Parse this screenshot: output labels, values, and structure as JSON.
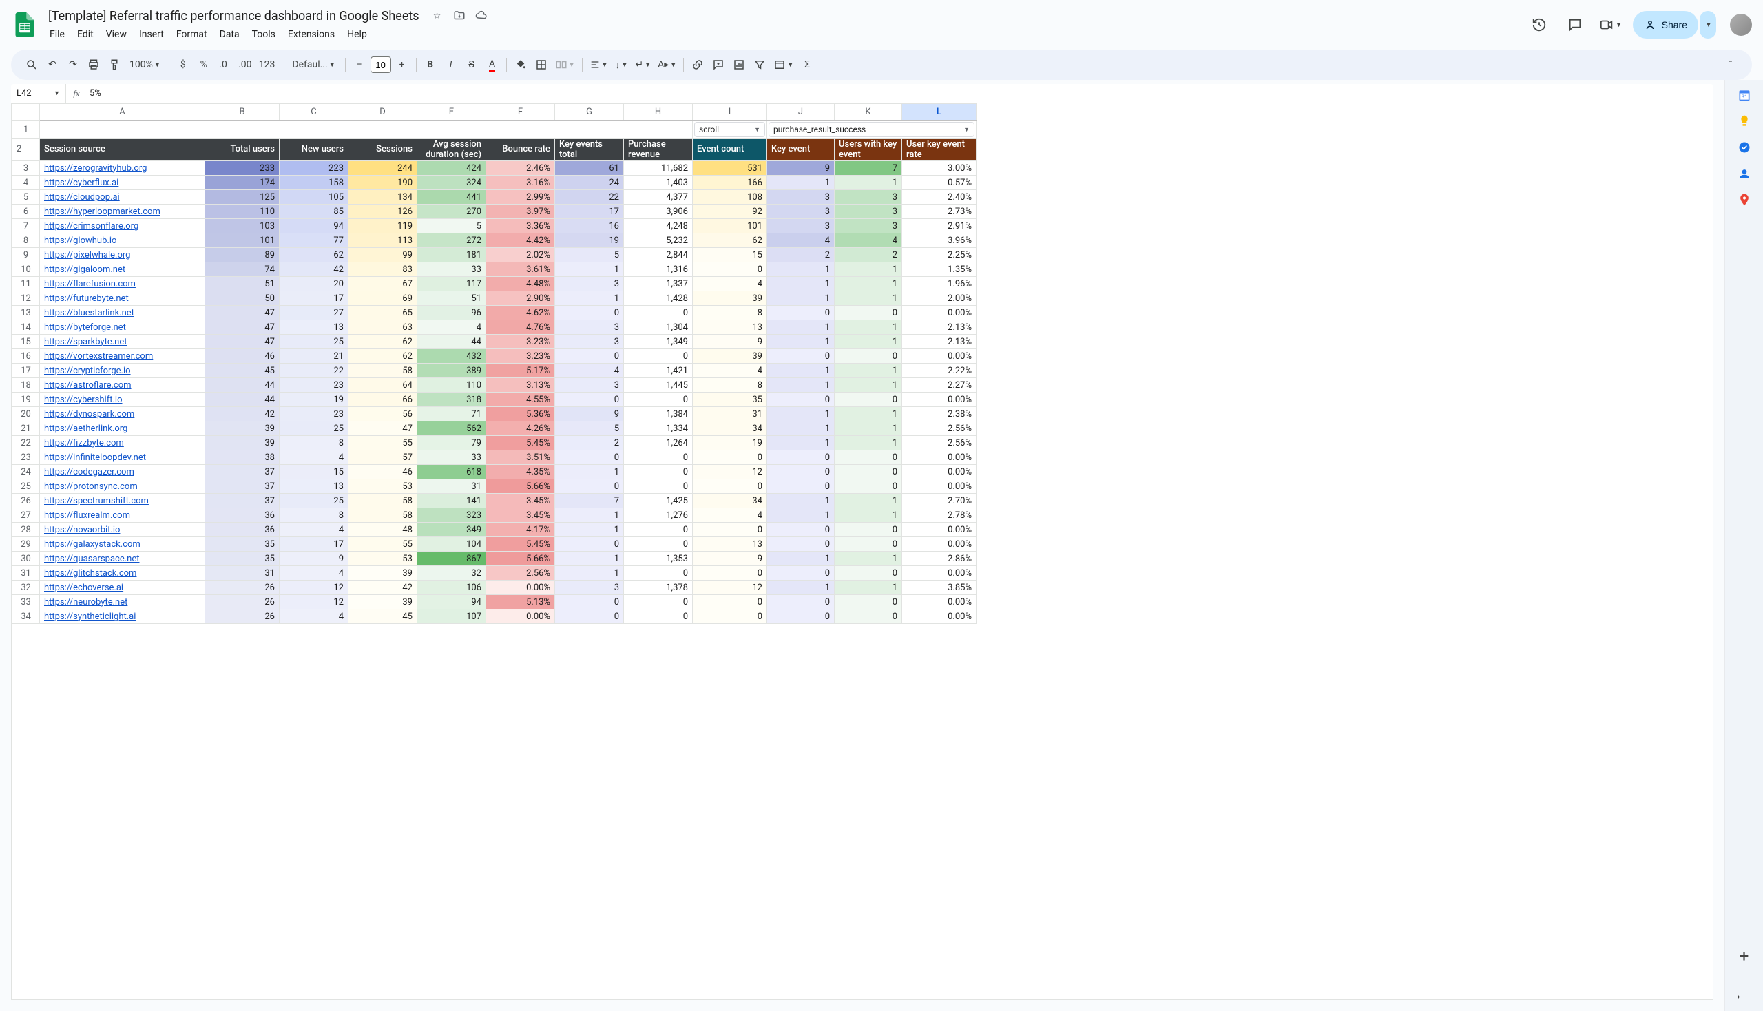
{
  "doc": {
    "title": "[Template] Referral traffic performance dashboard in Google Sheets"
  },
  "menu": {
    "file": "File",
    "edit": "Edit",
    "view": "View",
    "insert": "Insert",
    "format": "Format",
    "data": "Data",
    "tools": "Tools",
    "extensions": "Extensions",
    "help": "Help"
  },
  "share": {
    "label": "Share"
  },
  "toolbar": {
    "zoom": "100%",
    "font": "Defaul...",
    "size": "10"
  },
  "namebox": {
    "cell": "L42",
    "formula": "5%"
  },
  "filters": {
    "event_count": "scroll",
    "key_event": "purchase_result_success"
  },
  "cols": [
    "",
    "A",
    "B",
    "C",
    "D",
    "E",
    "F",
    "G",
    "H",
    "I",
    "J",
    "K",
    "L"
  ],
  "headers": {
    "a": "Session source",
    "b": "Total users",
    "c": "New users",
    "d": "Sessions",
    "e": "Avg session duration (sec)",
    "f": "Bounce rate",
    "g": "Key events total",
    "h": "Purchase revenue",
    "i": "Event count",
    "j": "Key event",
    "k": "Users with key event",
    "l": "User key event rate"
  },
  "rows": [
    {
      "a": "https://zerogravityhub.org",
      "b": "233",
      "c": "223",
      "d": "244",
      "e": "424",
      "f": "2.46%",
      "g": "61",
      "h": "11,682",
      "i": "531",
      "j": "9",
      "k": "7",
      "l": "3.00%"
    },
    {
      "a": "https://cyberflux.ai",
      "b": "174",
      "c": "158",
      "d": "190",
      "e": "324",
      "f": "3.16%",
      "g": "24",
      "h": "1,403",
      "i": "166",
      "j": "1",
      "k": "1",
      "l": "0.57%"
    },
    {
      "a": "https://cloudpop.ai",
      "b": "125",
      "c": "105",
      "d": "134",
      "e": "441",
      "f": "2.99%",
      "g": "22",
      "h": "4,377",
      "i": "108",
      "j": "3",
      "k": "3",
      "l": "2.40%"
    },
    {
      "a": "https://hyperloopmarket.com",
      "b": "110",
      "c": "85",
      "d": "126",
      "e": "270",
      "f": "3.97%",
      "g": "17",
      "h": "3,906",
      "i": "92",
      "j": "3",
      "k": "3",
      "l": "2.73%"
    },
    {
      "a": "https://crimsonflare.org",
      "b": "103",
      "c": "94",
      "d": "119",
      "e": "5",
      "f": "3.36%",
      "g": "16",
      "h": "4,248",
      "i": "101",
      "j": "3",
      "k": "3",
      "l": "2.91%"
    },
    {
      "a": "https://glowhub.io",
      "b": "101",
      "c": "77",
      "d": "113",
      "e": "272",
      "f": "4.42%",
      "g": "19",
      "h": "5,232",
      "i": "62",
      "j": "4",
      "k": "4",
      "l": "3.96%"
    },
    {
      "a": "https://pixelwhale.org",
      "b": "89",
      "c": "62",
      "d": "99",
      "e": "181",
      "f": "2.02%",
      "g": "5",
      "h": "2,844",
      "i": "15",
      "j": "2",
      "k": "2",
      "l": "2.25%"
    },
    {
      "a": "https://gigaloom.net",
      "b": "74",
      "c": "42",
      "d": "83",
      "e": "33",
      "f": "3.61%",
      "g": "1",
      "h": "1,316",
      "i": "0",
      "j": "1",
      "k": "1",
      "l": "1.35%"
    },
    {
      "a": "https://flarefusion.com",
      "b": "51",
      "c": "20",
      "d": "67",
      "e": "117",
      "f": "4.48%",
      "g": "3",
      "h": "1,337",
      "i": "4",
      "j": "1",
      "k": "1",
      "l": "1.96%"
    },
    {
      "a": "https://futurebyte.net",
      "b": "50",
      "c": "17",
      "d": "69",
      "e": "51",
      "f": "2.90%",
      "g": "1",
      "h": "1,428",
      "i": "39",
      "j": "1",
      "k": "1",
      "l": "2.00%"
    },
    {
      "a": "https://bluestarlink.net",
      "b": "47",
      "c": "27",
      "d": "65",
      "e": "96",
      "f": "4.62%",
      "g": "0",
      "h": "0",
      "i": "8",
      "j": "0",
      "k": "0",
      "l": "0.00%"
    },
    {
      "a": "https://byteforge.net",
      "b": "47",
      "c": "13",
      "d": "63",
      "e": "4",
      "f": "4.76%",
      "g": "3",
      "h": "1,304",
      "i": "13",
      "j": "1",
      "k": "1",
      "l": "2.13%"
    },
    {
      "a": "https://sparkbyte.net",
      "b": "47",
      "c": "25",
      "d": "62",
      "e": "44",
      "f": "3.23%",
      "g": "3",
      "h": "1,349",
      "i": "9",
      "j": "1",
      "k": "1",
      "l": "2.13%"
    },
    {
      "a": "https://vortexstreamer.com",
      "b": "46",
      "c": "21",
      "d": "62",
      "e": "432",
      "f": "3.23%",
      "g": "0",
      "h": "0",
      "i": "39",
      "j": "0",
      "k": "0",
      "l": "0.00%"
    },
    {
      "a": "https://crypticforge.io",
      "b": "45",
      "c": "22",
      "d": "58",
      "e": "389",
      "f": "5.17%",
      "g": "4",
      "h": "1,421",
      "i": "4",
      "j": "1",
      "k": "1",
      "l": "2.22%"
    },
    {
      "a": "https://astroflare.com",
      "b": "44",
      "c": "23",
      "d": "64",
      "e": "110",
      "f": "3.13%",
      "g": "3",
      "h": "1,445",
      "i": "8",
      "j": "1",
      "k": "1",
      "l": "2.27%"
    },
    {
      "a": "https://cybershift.io",
      "b": "44",
      "c": "19",
      "d": "66",
      "e": "318",
      "f": "4.55%",
      "g": "0",
      "h": "0",
      "i": "35",
      "j": "0",
      "k": "0",
      "l": "0.00%"
    },
    {
      "a": "https://dynospark.com",
      "b": "42",
      "c": "23",
      "d": "56",
      "e": "71",
      "f": "5.36%",
      "g": "9",
      "h": "1,384",
      "i": "31",
      "j": "1",
      "k": "1",
      "l": "2.38%"
    },
    {
      "a": "https://aetherlink.org",
      "b": "39",
      "c": "25",
      "d": "47",
      "e": "562",
      "f": "4.26%",
      "g": "5",
      "h": "1,334",
      "i": "34",
      "j": "1",
      "k": "1",
      "l": "2.56%"
    },
    {
      "a": "https://fizzbyte.com",
      "b": "39",
      "c": "8",
      "d": "55",
      "e": "79",
      "f": "5.45%",
      "g": "2",
      "h": "1,264",
      "i": "19",
      "j": "1",
      "k": "1",
      "l": "2.56%"
    },
    {
      "a": "https://infiniteloopdev.net",
      "b": "38",
      "c": "4",
      "d": "57",
      "e": "33",
      "f": "3.51%",
      "g": "0",
      "h": "0",
      "i": "0",
      "j": "0",
      "k": "0",
      "l": "0.00%"
    },
    {
      "a": "https://codegazer.com",
      "b": "37",
      "c": "15",
      "d": "46",
      "e": "618",
      "f": "4.35%",
      "g": "1",
      "h": "0",
      "i": "12",
      "j": "0",
      "k": "0",
      "l": "0.00%"
    },
    {
      "a": "https://protonsync.com",
      "b": "37",
      "c": "13",
      "d": "53",
      "e": "31",
      "f": "5.66%",
      "g": "0",
      "h": "0",
      "i": "0",
      "j": "0",
      "k": "0",
      "l": "0.00%"
    },
    {
      "a": "https://spectrumshift.com",
      "b": "37",
      "c": "25",
      "d": "58",
      "e": "141",
      "f": "3.45%",
      "g": "7",
      "h": "1,425",
      "i": "34",
      "j": "1",
      "k": "1",
      "l": "2.70%"
    },
    {
      "a": "https://fluxrealm.com",
      "b": "36",
      "c": "8",
      "d": "58",
      "e": "323",
      "f": "3.45%",
      "g": "1",
      "h": "1,276",
      "i": "4",
      "j": "1",
      "k": "1",
      "l": "2.78%"
    },
    {
      "a": "https://novaorbit.io",
      "b": "36",
      "c": "4",
      "d": "48",
      "e": "349",
      "f": "4.17%",
      "g": "1",
      "h": "0",
      "i": "0",
      "j": "0",
      "k": "0",
      "l": "0.00%"
    },
    {
      "a": "https://galaxystack.com",
      "b": "35",
      "c": "17",
      "d": "55",
      "e": "104",
      "f": "5.45%",
      "g": "0",
      "h": "0",
      "i": "13",
      "j": "0",
      "k": "0",
      "l": "0.00%"
    },
    {
      "a": "https://quasarspace.net",
      "b": "35",
      "c": "9",
      "d": "53",
      "e": "867",
      "f": "5.66%",
      "g": "1",
      "h": "1,353",
      "i": "9",
      "j": "1",
      "k": "1",
      "l": "2.86%"
    },
    {
      "a": "https://glitchstack.com",
      "b": "31",
      "c": "4",
      "d": "39",
      "e": "32",
      "f": "2.56%",
      "g": "1",
      "h": "0",
      "i": "0",
      "j": "0",
      "k": "0",
      "l": "0.00%"
    },
    {
      "a": "https://echoverse.ai",
      "b": "26",
      "c": "12",
      "d": "42",
      "e": "106",
      "f": "0.00%",
      "g": "3",
      "h": "1,378",
      "i": "12",
      "j": "1",
      "k": "1",
      "l": "3.85%"
    },
    {
      "a": "https://neurobyte.net",
      "b": "26",
      "c": "12",
      "d": "39",
      "e": "94",
      "f": "5.13%",
      "g": "0",
      "h": "0",
      "i": "0",
      "j": "0",
      "k": "0",
      "l": "0.00%"
    },
    {
      "a": "https://syntheticlight.ai",
      "b": "26",
      "c": "4",
      "d": "45",
      "e": "107",
      "f": "0.00%",
      "g": "0",
      "h": "0",
      "i": "0",
      "j": "0",
      "k": "0",
      "l": "0.00%"
    }
  ],
  "heat": {
    "b": {
      "min": 26,
      "max": 233,
      "low": "#e8eaf6",
      "high": "#7986cb"
    },
    "c": {
      "min": 4,
      "max": 223,
      "low": "#eef0fa",
      "high": "#b0bdf0"
    },
    "d": {
      "min": 39,
      "max": 244,
      "low": "#fffef7",
      "high": "#ffe082"
    },
    "e": {
      "min": 4,
      "max": 867,
      "low": "#f1f8f2",
      "high": "#66bb6a"
    },
    "f": {
      "min": 0,
      "max": 5.7,
      "low": "#fdecea",
      "high": "#ef9a9a"
    },
    "g": {
      "min": 0,
      "max": 61,
      "low": "#edeefc",
      "high": "#9fa8da"
    },
    "i": {
      "min": 0,
      "max": 531,
      "low": "#fffef7",
      "high": "#ffe082"
    },
    "j": {
      "min": 0,
      "max": 9,
      "low": "#edeefc",
      "high": "#9fa8da"
    },
    "k": {
      "min": 0,
      "max": 7,
      "low": "#f1f8f2",
      "high": "#81c784"
    }
  }
}
